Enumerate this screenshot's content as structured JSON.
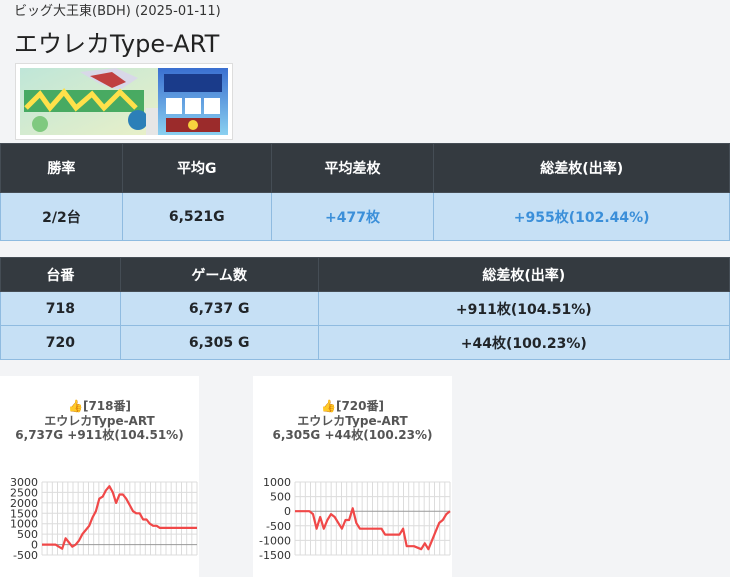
{
  "page": {
    "subtitle": "ビッグ大王東(BDH) (2025-01-11)",
    "title": "エウレカType-ART"
  },
  "summary": {
    "headers": [
      "勝率",
      "平均G",
      "平均差枚",
      "総差枚(出率)"
    ],
    "row": [
      "2/2台",
      "6,521G",
      "+477枚",
      "+955枚(102.44%)"
    ]
  },
  "machines": {
    "headers": [
      "台番",
      "ゲーム数",
      "総差枚(出率)"
    ],
    "rows": [
      [
        "718",
        "6,737 G",
        "+911枚(104.51%)"
      ],
      [
        "720",
        "6,305 G",
        "+44枚(100.23%)"
      ]
    ]
  },
  "colors": {
    "header_bg": "#343a40",
    "row_bg": "#c6e0f5",
    "positive_text": "#3b8fd9",
    "line": "#f04848"
  },
  "cards": [
    {
      "icon": "thumbs-up-icon",
      "line1": "👍[718番]",
      "line2": "エウレカType-ART",
      "line3": "6,737G +911枚(104.51%)"
    },
    {
      "icon": "thumbs-up-icon",
      "line1": "👍[720番]",
      "line2": "エウレカType-ART",
      "line3": "6,305G +44枚(100.23%)"
    }
  ],
  "chart_data": [
    {
      "type": "line",
      "title": "",
      "xlabel": "",
      "ylabel": "",
      "yticks": [
        "3000",
        "2500",
        "2000",
        "1500",
        "1000",
        "500",
        "0",
        "-500"
      ],
      "ylim": [
        -500,
        3000
      ],
      "grid": true,
      "series": [
        {
          "values": [
            0,
            0,
            0,
            0,
            0,
            -100,
            -200,
            300,
            100,
            -100,
            0,
            200,
            500,
            700,
            900,
            1300,
            1600,
            2200,
            2300,
            2600,
            2800,
            2500,
            2000,
            2400,
            2400,
            2200,
            1900,
            1600,
            1500,
            1500,
            1200,
            1200,
            1000,
            900,
            900,
            800,
            800,
            800,
            800,
            800,
            800,
            800,
            800,
            800,
            800,
            800,
            800
          ]
        }
      ]
    },
    {
      "type": "line",
      "title": "",
      "xlabel": "",
      "ylabel": "",
      "yticks": [
        "1000",
        "500",
        "0",
        "-500",
        "-1000",
        "-1500"
      ],
      "ylim": [
        -1500,
        1000
      ],
      "grid": true,
      "series": [
        {
          "values": [
            0,
            0,
            0,
            0,
            0,
            -100,
            -600,
            -200,
            -600,
            -300,
            -100,
            -200,
            -400,
            -600,
            -300,
            -300,
            100,
            -400,
            -600,
            -600,
            -600,
            -600,
            -600,
            -600,
            -600,
            -800,
            -800,
            -800,
            -800,
            -800,
            -600,
            -1200,
            -1200,
            -1200,
            -1250,
            -1300,
            -1100,
            -1300,
            -1000,
            -700,
            -400,
            -300,
            -100,
            0
          ]
        }
      ]
    }
  ]
}
